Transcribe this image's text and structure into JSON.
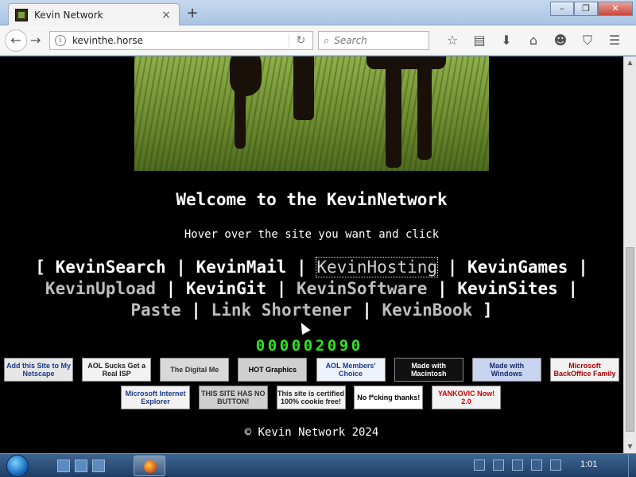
{
  "browser": {
    "tab_title": "Kevin Network",
    "tab_close": "×",
    "new_tab": "+",
    "url": "kevinthe.horse",
    "search_placeholder": "Search",
    "window_buttons": [
      "–",
      "❐",
      "✕"
    ]
  },
  "page": {
    "welcome": "Welcome to the KevinNetwork",
    "hover_text": "Hover over the site you want and click",
    "links": [
      {
        "label": "KevinSearch",
        "style": "white"
      },
      {
        "label": "KevinMail",
        "style": "white"
      },
      {
        "label": "KevinHosting",
        "style": "hover"
      },
      {
        "label": "KevinGames",
        "style": "white"
      },
      {
        "label": "KevinUpload",
        "style": "grey"
      },
      {
        "label": "KevinGit",
        "style": "white"
      },
      {
        "label": "KevinSoftware",
        "style": "grey"
      },
      {
        "label": "KevinSites",
        "style": "white"
      },
      {
        "label": "Paste",
        "style": "grey"
      },
      {
        "label": "Link Shortener",
        "style": "grey"
      },
      {
        "label": "KevinBook",
        "style": "grey"
      }
    ],
    "counter": "000002090",
    "counter_color": "#2ee820",
    "footer": "© Kevin Network 2024"
  },
  "badges_row1": [
    {
      "text": "Add this Site to My Netscape",
      "bg": "#e6e6e6",
      "fg": "#1b3a8a"
    },
    {
      "text": "AOL Sucks Get a Real ISP",
      "bg": "#f2f2f2",
      "fg": "#222"
    },
    {
      "text": "The Digital Me",
      "bg": "#d9d9d9",
      "fg": "#333"
    },
    {
      "text": "HOT Graphics",
      "bg": "#cfcfcf",
      "fg": "#000"
    },
    {
      "text": "AOL Members' Choice",
      "bg": "#eef2fa",
      "fg": "#1b3a8a"
    },
    {
      "text": "Made with Macintosh",
      "bg": "#111111",
      "fg": "#ffffff"
    },
    {
      "text": "Made with Windows",
      "bg": "#c8d4f0",
      "fg": "#1b2a6a"
    },
    {
      "text": "Microsoft BackOffice Family",
      "bg": "#f2f2f2",
      "fg": "#a00"
    }
  ],
  "badges_row2": [
    {
      "text": "Microsoft Internet Explorer",
      "bg": "#f2f2f2",
      "fg": "#1b3a8a"
    },
    {
      "text": "THIS SITE HAS NO BUTTON!",
      "bg": "#cfcfcf",
      "fg": "#333"
    },
    {
      "text": "This site is certified 100% cookie free!",
      "bg": "#f2f2f2",
      "fg": "#222"
    },
    {
      "text": "No f*cking thanks!",
      "bg": "#ffffff",
      "fg": "#000"
    },
    {
      "text": "YANKOVIC Now! 2.0",
      "bg": "#f2f2f2",
      "fg": "#c00"
    }
  ],
  "taskbar": {
    "clock": "1:01"
  }
}
